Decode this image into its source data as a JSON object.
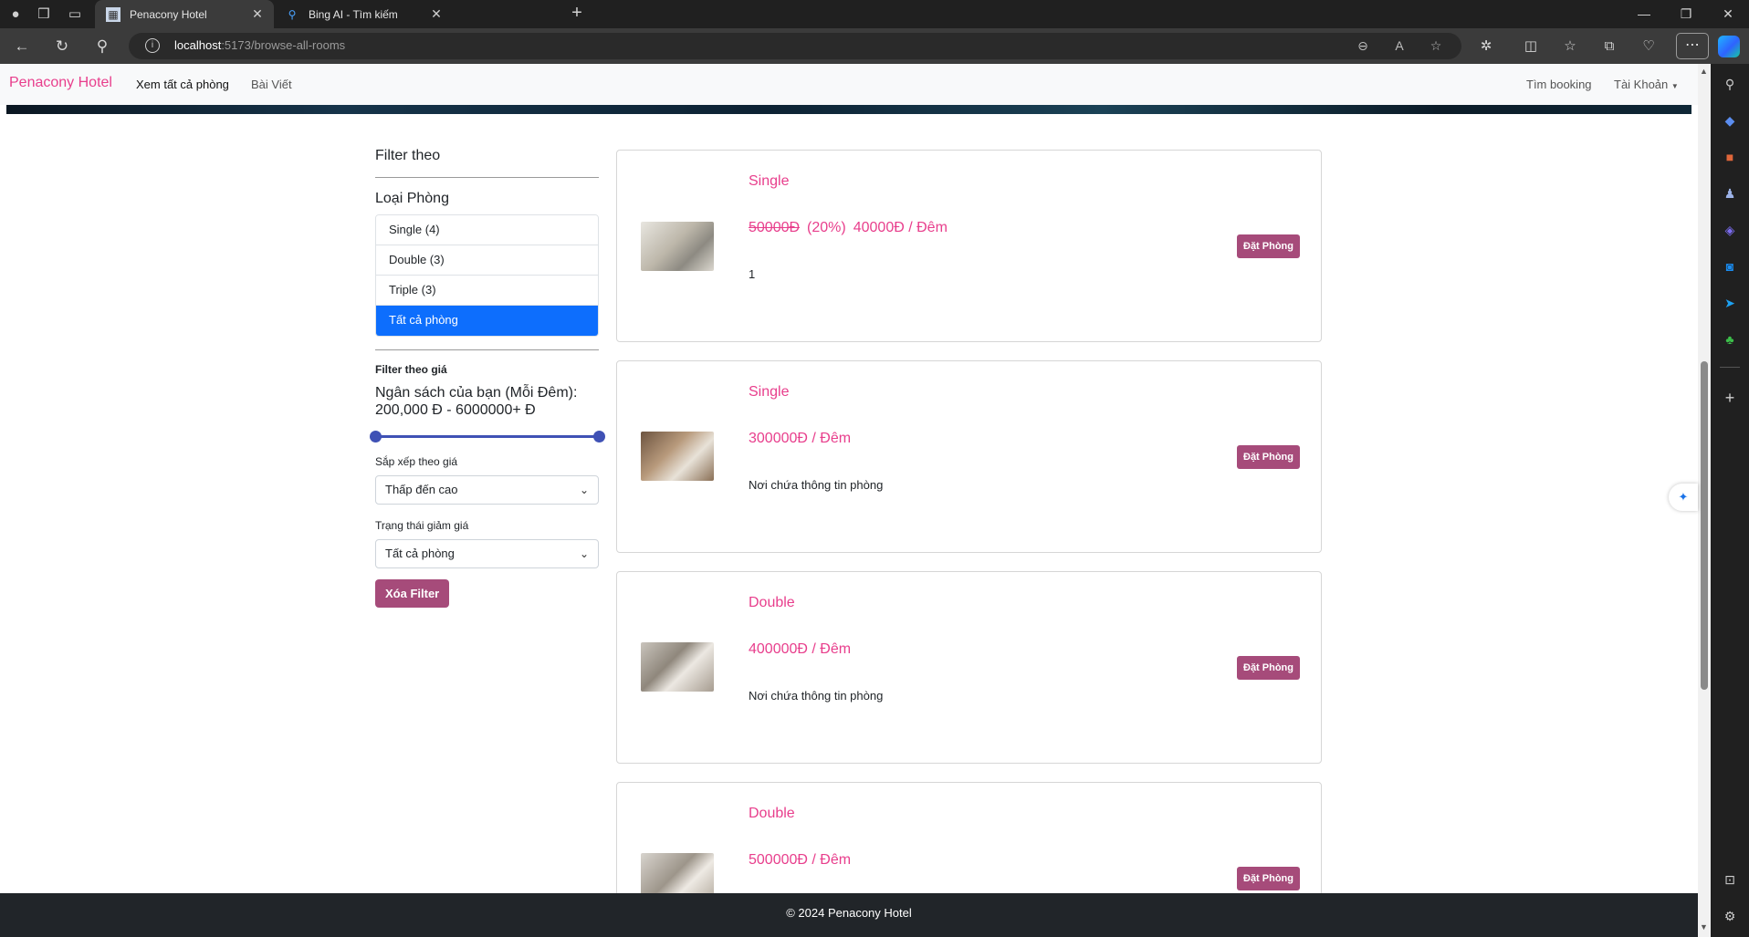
{
  "browser": {
    "tabs": [
      {
        "title": "Penacony Hotel",
        "active": true
      },
      {
        "title": "Bing AI - Tìm kiếm",
        "active": false
      }
    ],
    "url_host": "localhost",
    "url_path": ":5173/browse-all-rooms"
  },
  "navbar": {
    "brand": "Penacony Hotel",
    "links": [
      "Xem tất cả phòng",
      "Bài Viết"
    ],
    "right_links": [
      "Tìm booking",
      "Tài Khoản"
    ]
  },
  "filter": {
    "title": "Filter theo",
    "room_type_title": "Loại Phòng",
    "room_types": [
      "Single (4)",
      "Double (3)",
      "Triple (3)",
      "Tất cả phòng"
    ],
    "price_filter_label": "Filter theo giá",
    "budget_line1": "Ngân sách của bạn (Mỗi Đêm):",
    "budget_line2": "200,000 Đ - 6000000+ Đ",
    "budget_min_fraction": 0,
    "budget_max_fraction": 1,
    "sort_label": "Sắp xếp theo giá",
    "sort_value": "Thấp đến cao",
    "discount_label": "Trạng thái giảm giá",
    "discount_value": "Tất cả phòng",
    "clear_button": "Xóa Filter"
  },
  "rooms": [
    {
      "type": "Single",
      "old_price": "50000Đ",
      "discount": "(20%)",
      "price": "40000Đ / Đêm",
      "desc": "1",
      "book": "Đặt Phòng"
    },
    {
      "type": "Single",
      "old_price": "",
      "discount": "",
      "price": "300000Đ / Đêm",
      "desc": "Nơi chứa thông tin phòng",
      "book": "Đặt Phòng"
    },
    {
      "type": "Double",
      "old_price": "",
      "discount": "",
      "price": "400000Đ / Đêm",
      "desc": "Nơi chứa thông tin phòng",
      "book": "Đặt Phòng"
    },
    {
      "type": "Double",
      "old_price": "",
      "discount": "",
      "price": "500000Đ / Đêm",
      "desc": "",
      "book": "Đặt Phòng"
    }
  ],
  "footer": {
    "text": "© 2024 Penacony Hotel"
  },
  "colors": {
    "brand": "#e83e8c",
    "button": "#a64b7a",
    "active_list": "#0d6efd",
    "footer": "#212529"
  }
}
